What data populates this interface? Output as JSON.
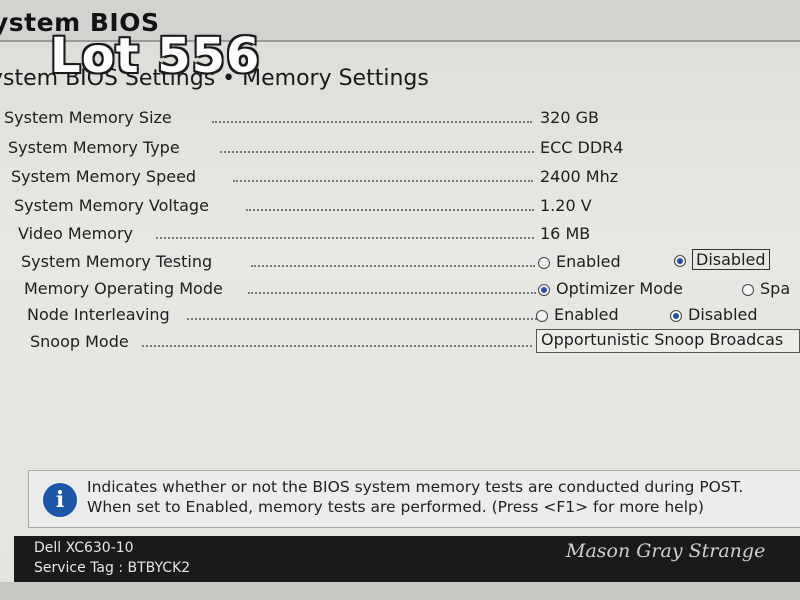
{
  "app_title": "ystem BIOS",
  "overlay": {
    "lot": "Lot 556"
  },
  "breadcrumb": "ystem BIOS Settings • Memory Settings",
  "rows": [
    {
      "label": "System Memory Size",
      "value": "320 GB"
    },
    {
      "label": "System Memory Type",
      "value": "ECC DDR4"
    },
    {
      "label": "System Memory Speed",
      "value": "2400 Mhz"
    },
    {
      "label": "System Memory Voltage",
      "value": "1.20 V"
    },
    {
      "label": "Video Memory",
      "value": "16 MB"
    },
    {
      "label": "System Memory Testing",
      "options": [
        "Enabled",
        "Disabled"
      ],
      "selected": "Disabled"
    },
    {
      "label": "Memory Operating Mode",
      "options": [
        "Optimizer Mode",
        "Spa"
      ],
      "selected": "Optimizer Mode"
    },
    {
      "label": "Node Interleaving",
      "options": [
        "Enabled",
        "Disabled"
      ],
      "selected": "Disabled"
    },
    {
      "label": "Snoop Mode",
      "value": "Opportunistic Snoop Broadcas"
    }
  ],
  "help": {
    "line1": "Indicates whether or not the BIOS system memory tests are conducted during POST.",
    "line2": "When set to Enabled, memory tests are performed. (Press <F1> for more help)"
  },
  "footer": {
    "model": "Dell XC630-10",
    "service_tag": "Service Tag : BTBYCK2",
    "signature": "Mason Gray Strange"
  }
}
